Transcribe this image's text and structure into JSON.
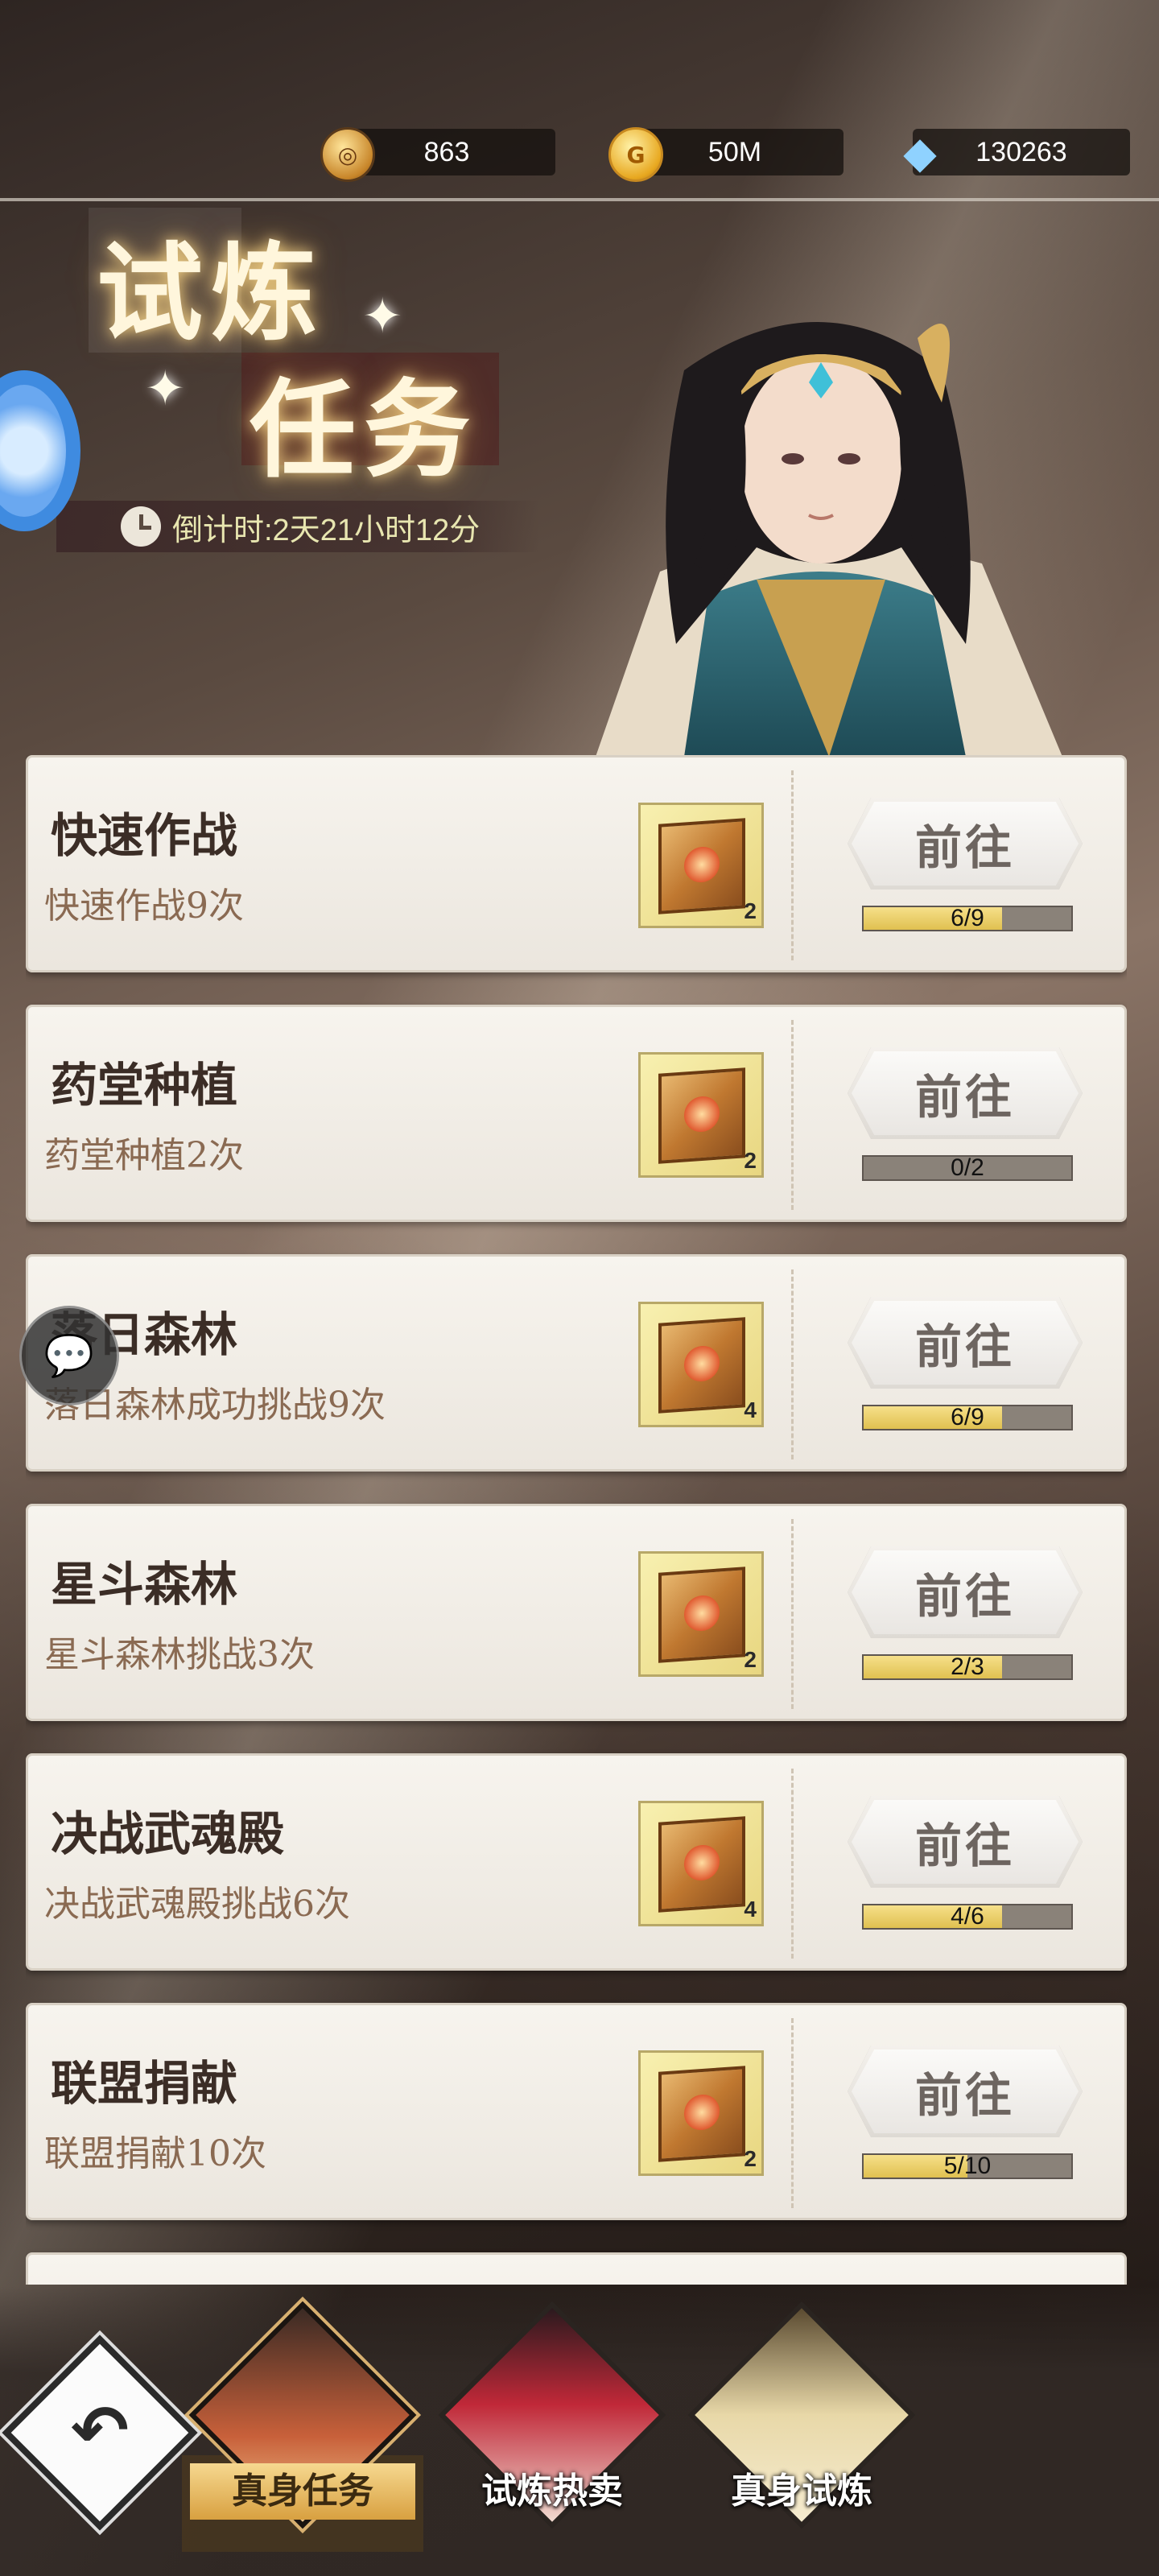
{
  "currencies": [
    {
      "icon": "token-coin-icon",
      "value": "863"
    },
    {
      "icon": "gold-coin-icon",
      "value": "50M"
    },
    {
      "icon": "diamond-icon",
      "value": "130263"
    }
  ],
  "title": {
    "line1": "试炼",
    "line2": "任务"
  },
  "countdown": "倒计时:2天21小时12分",
  "go_label": "前往",
  "tasks": [
    {
      "name": "快速作战",
      "desc": "快速作战9次",
      "reward_count": "2",
      "progress": "6/9",
      "fraction": 0.667
    },
    {
      "name": "药堂种植",
      "desc": "药堂种植2次",
      "reward_count": "2",
      "progress": "0/2",
      "fraction": 0.0
    },
    {
      "name": "落日森林",
      "desc": "落日森林成功挑战9次",
      "reward_count": "4",
      "progress": "6/9",
      "fraction": 0.667
    },
    {
      "name": "星斗森林",
      "desc": "星斗森林挑战3次",
      "reward_count": "2",
      "progress": "2/3",
      "fraction": 0.667
    },
    {
      "name": "决战武魂殿",
      "desc": "决战武魂殿挑战6次",
      "reward_count": "4",
      "progress": "4/6",
      "fraction": 0.667
    },
    {
      "name": "联盟捐献",
      "desc": "联盟捐献10次",
      "reward_count": "2",
      "progress": "5/10",
      "fraction": 0.5
    }
  ],
  "nav": [
    {
      "label": "真身任务",
      "active": true
    },
    {
      "label": "试炼热卖",
      "active": false
    },
    {
      "label": "真身试炼",
      "active": false
    }
  ]
}
